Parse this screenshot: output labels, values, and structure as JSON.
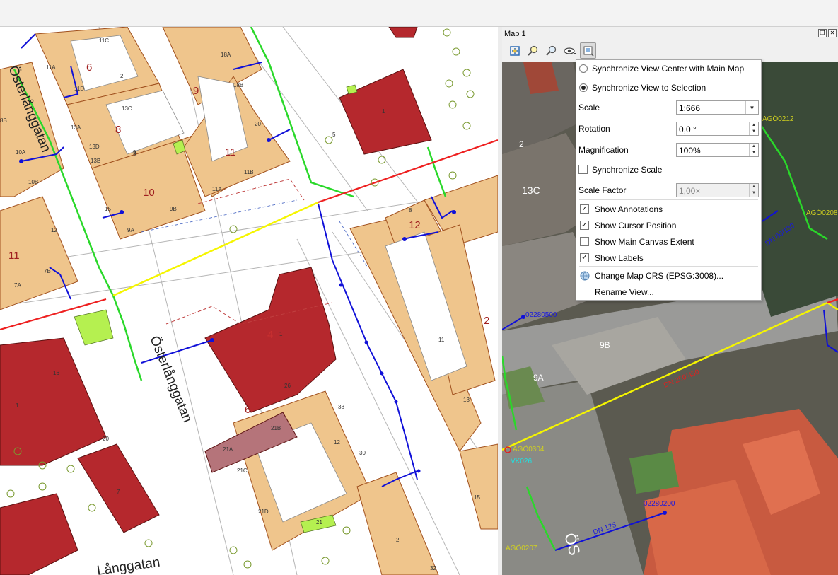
{
  "panel": {
    "title": "Map 1",
    "float_btn": "❐",
    "close_btn": "✕",
    "toolbar": [
      {
        "name": "zoom-full-icon"
      },
      {
        "name": "zoom-to-selection-icon"
      },
      {
        "name": "zoom-to-layer-icon"
      },
      {
        "name": "view-theme-icon"
      },
      {
        "name": "view-settings-icon"
      }
    ]
  },
  "menu": {
    "sync_center": "Synchronize View Center with Main Map",
    "sync_selection": "Synchronize View to Selection",
    "scale_label": "Scale",
    "scale_value": "1:666",
    "rotation_label": "Rotation",
    "rotation_value": "0,0 °",
    "magnification_label": "Magnification",
    "magnification_value": "100%",
    "sync_scale": "Synchronize Scale",
    "scale_factor_label": "Scale Factor",
    "scale_factor_value": "1,00×",
    "show_annotations": "Show Annotations",
    "show_cursor": "Show Cursor Position",
    "show_extent": "Show Main Canvas Extent",
    "show_labels": "Show Labels",
    "change_crs": "Change Map CRS (EPSG:3008)...",
    "rename_view": "Rename View...",
    "check_mark": "✓"
  },
  "main_map": {
    "street1": "Österlånggatan",
    "street2": "Österlånggatan",
    "street3": "Långgatan",
    "blocks": [
      "6",
      "9",
      "8",
      "11",
      "10",
      "11",
      "12",
      "2",
      "4",
      "6"
    ],
    "parcels": [
      "11C",
      "11A",
      "11D",
      "18A",
      "18B",
      "13C",
      "13A",
      "13D",
      "13B",
      "2",
      "3",
      "20",
      "11B",
      "11A",
      "9B",
      "9A",
      "15",
      "10B",
      "10A",
      "8B",
      "7B",
      "7A",
      "12",
      "8",
      "1",
      "5",
      "16",
      "1",
      "20",
      "7",
      "21B",
      "21A",
      "21C",
      "21D",
      "12",
      "30",
      "2",
      "11",
      "13",
      "15",
      "9",
      "1",
      "21",
      "32",
      "26",
      "38"
    ]
  },
  "overview": {
    "labels": [
      "AGÖ0212",
      "AGÖ0208",
      "AGÖ0304",
      "AGÖ0207",
      "02280500",
      "02280200",
      "VK026",
      "DN 250/450",
      "DN 80/180",
      "DN 125",
      "13C",
      "9B",
      "9A",
      "2",
      "ÖS"
    ]
  }
}
